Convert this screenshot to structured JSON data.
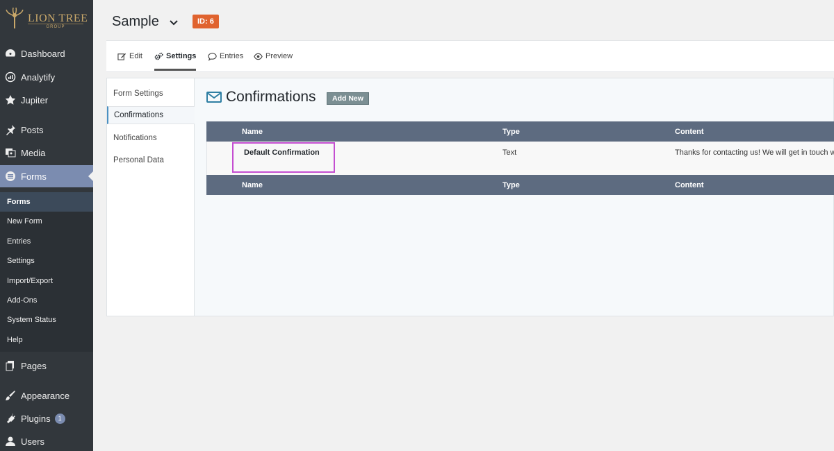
{
  "logo": {
    "brand": "LION TREE",
    "sub": "GROUP"
  },
  "sidebar": {
    "items": [
      {
        "label": "Dashboard",
        "icon": "dashboard-icon"
      },
      {
        "label": "Analytify",
        "icon": "analytics-icon"
      },
      {
        "label": "Jupiter",
        "icon": "star-icon"
      },
      {
        "label": "Posts",
        "icon": "pin-icon"
      },
      {
        "label": "Media",
        "icon": "media-icon"
      },
      {
        "label": "Forms",
        "icon": "forms-icon"
      },
      {
        "label": "Pages",
        "icon": "pages-icon"
      },
      {
        "label": "Appearance",
        "icon": "brush-icon"
      },
      {
        "label": "Plugins",
        "icon": "plugin-icon",
        "badge": "1"
      },
      {
        "label": "Users",
        "icon": "user-icon"
      }
    ],
    "submenu": [
      "Forms",
      "New Form",
      "Entries",
      "Settings",
      "Import/Export",
      "Add-Ons",
      "System Status",
      "Help"
    ]
  },
  "header": {
    "title": "Sample",
    "id_badge": "ID: 6"
  },
  "tabs": [
    "Edit",
    "Settings",
    "Entries",
    "Preview"
  ],
  "subnav": [
    "Form Settings",
    "Confirmations",
    "Notifications",
    "Personal Data"
  ],
  "section": {
    "title": "Confirmations",
    "add_new": "Add New"
  },
  "table": {
    "columns": [
      "Name",
      "Type",
      "Content"
    ],
    "rows": [
      {
        "name": "Default Confirmation",
        "type": "Text",
        "content": "Thanks for contacting us! We will get in touch w"
      }
    ]
  },
  "colors": {
    "sidebar": "#32373c",
    "active": "#7b8cb0",
    "id_badge": "#e0632f",
    "table_header": "#5d6b80",
    "highlight": "#c44ed1"
  }
}
